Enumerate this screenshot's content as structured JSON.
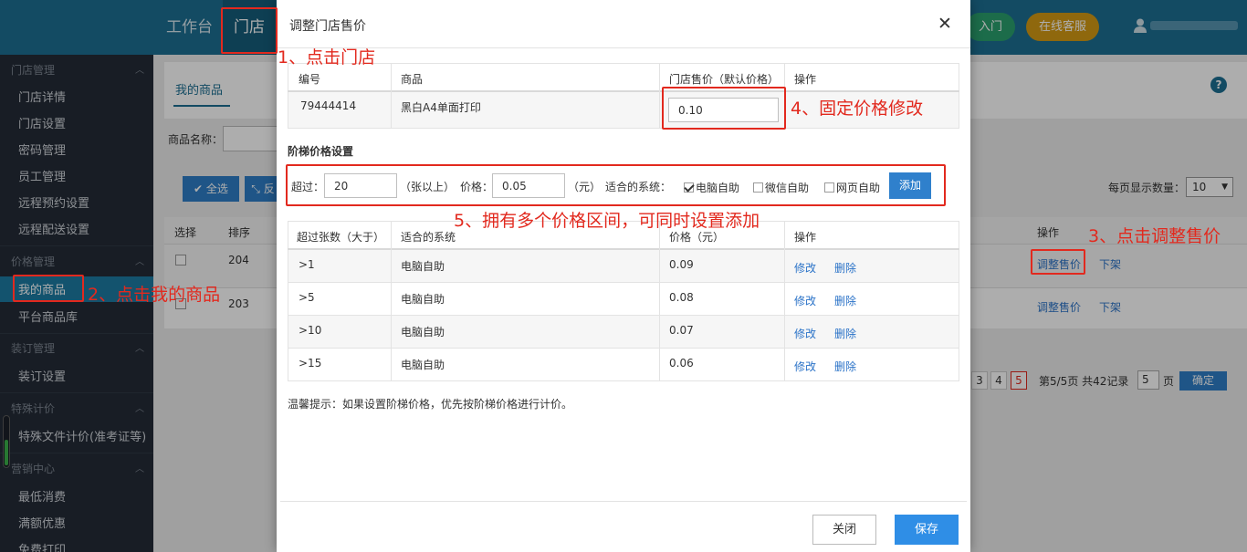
{
  "topbar": {
    "nav": [
      "工作台",
      "门店"
    ],
    "entry_label": "入门",
    "service_label": "在线客服"
  },
  "sidebar": {
    "groups": [
      {
        "title": "门店管理",
        "items": [
          "门店详情",
          "门店设置",
          "密码管理",
          "员工管理",
          "远程预约设置",
          "远程配送设置"
        ]
      },
      {
        "title": "价格管理",
        "items": [
          "我的商品",
          "平台商品库"
        ]
      },
      {
        "title": "装订管理",
        "items": [
          "装订设置"
        ]
      },
      {
        "title": "特殊计价",
        "items": [
          "特殊文件计价(准考证等)"
        ]
      },
      {
        "title": "营销中心",
        "items": [
          "最低消费",
          "满额优惠",
          "免费打印"
        ]
      }
    ]
  },
  "page": {
    "tab_label": "我的商品",
    "search_label": "商品名称：",
    "select_all_label": "全选",
    "second_btn_label": "反",
    "page_size_label": "每页显示数量：",
    "page_size_value": "10",
    "table_headers": [
      "选择",
      "排序",
      "操作"
    ],
    "rows": [
      {
        "sort": "204",
        "adjust": "调整售价",
        "off": "下架"
      },
      {
        "sort": "203",
        "adjust": "调整售价",
        "off": "下架"
      }
    ],
    "pages": [
      "3",
      "4",
      "5"
    ],
    "page_info": "第5/5页 共42记录",
    "page_input": "5",
    "page_unit": "页",
    "confirm_label": "确定"
  },
  "modal": {
    "title": "调整门店售价",
    "close_glyph": "✕",
    "product_headers": [
      "编号",
      "商品",
      "门店售价（默认价格）",
      "操作"
    ],
    "product": {
      "code": "79444414",
      "name": "黑白A4单面打印",
      "price": "0.10"
    },
    "tier_section_title": "阶梯价格设置",
    "tier_form": {
      "exceed_label": "超过：",
      "exceed_value": "20",
      "sheets_unit": "（张以上）",
      "price_label": "价格：",
      "price_value": "0.05",
      "yuan_unit": "（元）",
      "system_label": "适合的系统：",
      "systems": [
        {
          "label": "电脑自助",
          "checked": true
        },
        {
          "label": "微信自助",
          "checked": false
        },
        {
          "label": "网页自助",
          "checked": false
        }
      ],
      "add_label": "添加"
    },
    "tier_headers": [
      "超过张数（大于）",
      "适合的系统",
      "价格（元）",
      "操作"
    ],
    "tiers": [
      {
        "count": ">1",
        "system": "电脑自助",
        "price": "0.09",
        "edit": "修改",
        "del": "删除"
      },
      {
        "count": ">5",
        "system": "电脑自助",
        "price": "0.08",
        "edit": "修改",
        "del": "删除"
      },
      {
        "count": ">10",
        "system": "电脑自助",
        "price": "0.07",
        "edit": "修改",
        "del": "删除"
      },
      {
        "count": ">15",
        "system": "电脑自助",
        "price": "0.06",
        "edit": "修改",
        "del": "删除"
      }
    ],
    "tip": "温馨提示：如果设置阶梯价格，优先按阶梯价格进行计价。",
    "cancel_label": "关闭",
    "save_label": "保存"
  },
  "annotations": {
    "a1": "1、点击门店",
    "a2": "2、点击我的商品",
    "a3": "3、点击调整售价",
    "a4": "4、固定价格修改",
    "a5": "5、拥有多个价格区间，可同时设置添加"
  },
  "colors": {
    "topbar": "#1c6f92",
    "sidebar": "#242c37",
    "accent": "#2f8ee6",
    "annotation": "#e2291e"
  }
}
